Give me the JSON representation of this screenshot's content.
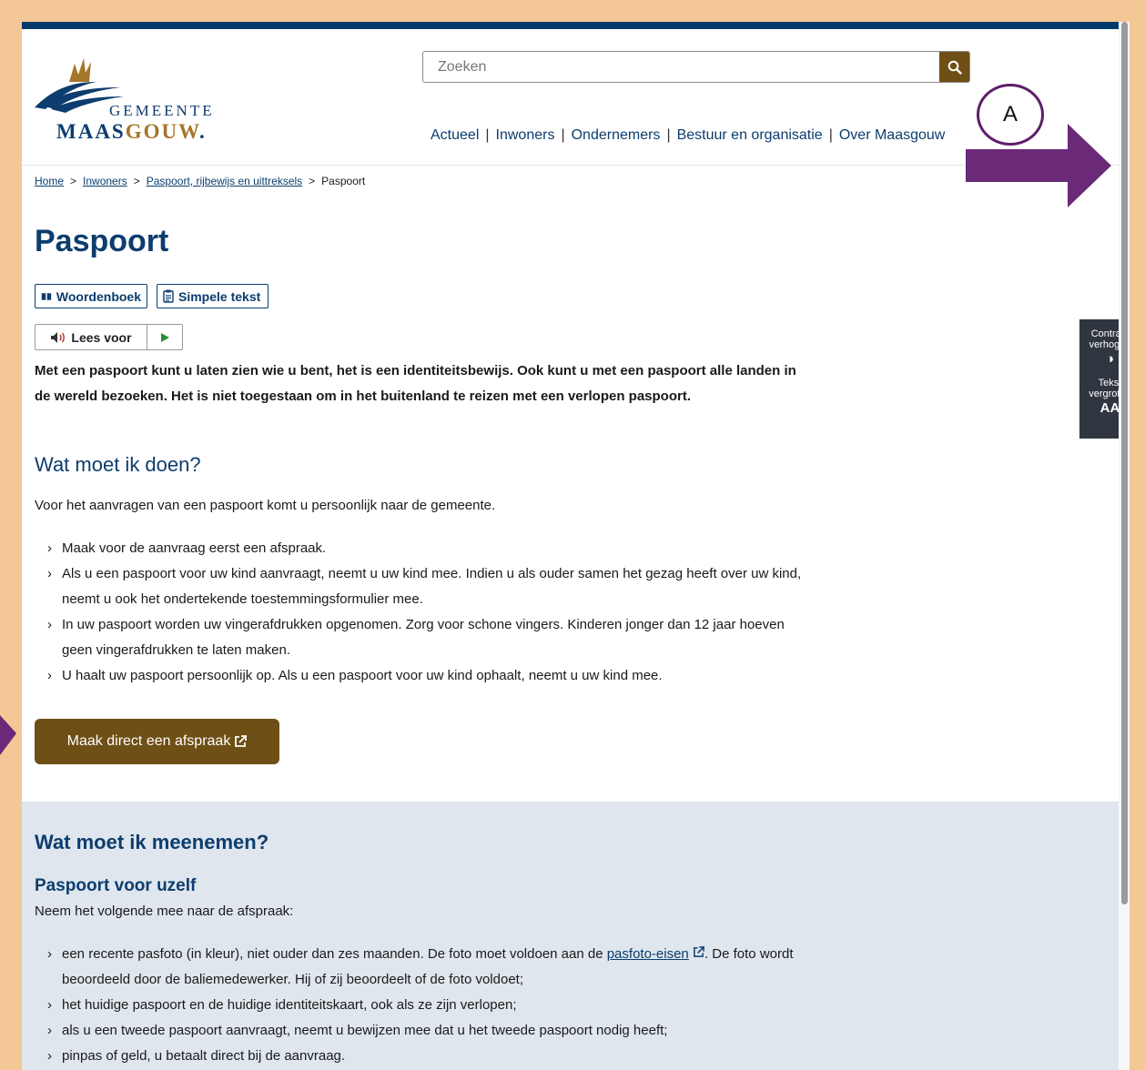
{
  "logo": {
    "line1": "GEMEENTE",
    "line2_a": "MAAS",
    "line2_b": "GOUW",
    "line2_c": "."
  },
  "search": {
    "placeholder": "Zoeken"
  },
  "nav": [
    "Actueel",
    "Inwoners",
    "Ondernemers",
    "Bestuur en organisatie",
    "Over Maasgouw"
  ],
  "annotation": {
    "label": "A"
  },
  "breadcrumb": {
    "home": "Home",
    "inwoners": "Inwoners",
    "paspoort_section": "Paspoort, rijbewijs en uittreksels",
    "current": "Paspoort"
  },
  "page_title": "Paspoort",
  "tools": {
    "woordenboek": "Woordenboek",
    "simpele_tekst": "Simpele tekst",
    "lees_voor": "Lees voor"
  },
  "intro": "Met een paspoort kunt u laten zien wie u bent, het is een identiteitsbewijs. Ook kunt u met een paspoort alle landen in de wereld bezoeken. Het is niet toegestaan om in het buitenland te reizen met een verlopen paspoort.",
  "doen": {
    "heading": "Wat moet ik doen?",
    "text": "Voor het aanvragen van een paspoort komt u persoonlijk naar de gemeente.",
    "items": [
      "Maak voor de aanvraag eerst een afspraak.",
      "Als u een paspoort voor uw kind aanvraagt, neemt u uw kind mee. Indien u als ouder samen het gezag heeft over uw kind, neemt u ook het ondertekende toestemmingsformulier mee.",
      "In uw paspoort worden uw vingerafdrukken opgenomen. Zorg voor schone vingers. Kinderen jonger dan 12 jaar hoeven geen vingerafdrukken te laten maken.",
      "U haalt uw paspoort persoonlijk op. Als u een paspoort voor uw kind ophaalt, neemt u uw kind mee."
    ],
    "cta": "Maak direct een afspraak"
  },
  "meenemen": {
    "heading": "Wat moet ik meenemen?",
    "subheading": "Paspoort voor uzelf",
    "text": "Neem het volgende mee naar de afspraak:",
    "item1_before": "een recente pasfoto (in kleur), niet ouder dan zes maanden. De foto moet voldoen aan de ",
    "item1_link": "pasfoto-eisen",
    "item1_after": ". De foto wordt beoordeeld door de baliemedewerker. Hij of zij beoordeelt of de foto voldoet;",
    "items": [
      "het huidige paspoort en de huidige identiteitskaart, ook als ze zijn verlopen;",
      "als u een tweede paspoort aanvraagt, neemt u bewijzen mee dat u het tweede paspoort nodig heeft;",
      "pinpas of geld, u betaalt direct bij de aanvraag."
    ]
  },
  "a11y": {
    "contrast_1": "Contrast",
    "contrast_2": "verhogen",
    "text_1": "Tekst",
    "text_2": "vergroten",
    "text_icon": "AA"
  },
  "colors": {
    "brand_blue": "#0c3d6e",
    "brand_brown": "#6e4f16",
    "annotation_purple": "#6a2a78",
    "background_frame": "#f3c896"
  }
}
